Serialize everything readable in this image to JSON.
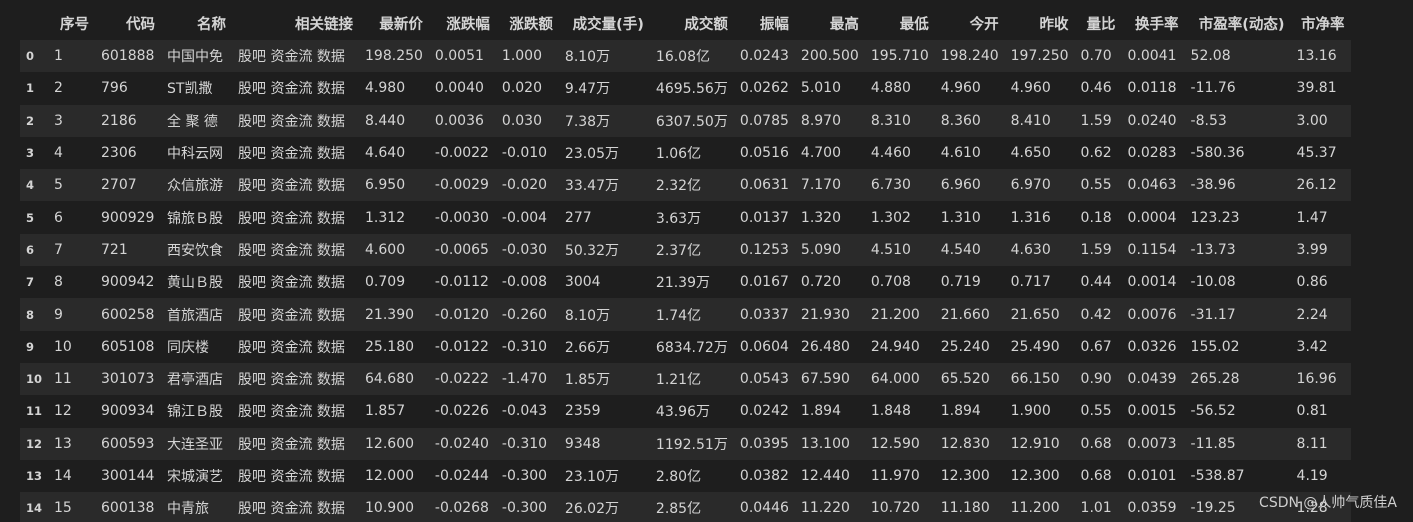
{
  "table": {
    "columns": [
      "",
      "序号",
      "代码",
      "名称",
      "相关链接",
      "最新价",
      "涨跌幅",
      "涨跌额",
      "成交量(手)",
      "成交额",
      "振幅",
      "最高",
      "最低",
      "今开",
      "昨收",
      "量比",
      "换手率",
      "市盈率(动态)",
      "市净率"
    ],
    "rows": [
      [
        "0",
        "1",
        "601888",
        "中国中免",
        "股吧 资金流 数据",
        "198.250",
        "0.0051",
        "1.000",
        "8.10万",
        "16.08亿",
        "0.0243",
        "200.500",
        "195.710",
        "198.240",
        "197.250",
        "0.70",
        "0.0041",
        "52.08",
        "13.16"
      ],
      [
        "1",
        "2",
        "796",
        "ST凯撒",
        "股吧 资金流 数据",
        "4.980",
        "0.0040",
        "0.020",
        "9.47万",
        "4695.56万",
        "0.0262",
        "5.010",
        "4.880",
        "4.960",
        "4.960",
        "0.46",
        "0.0118",
        "-11.76",
        "39.81"
      ],
      [
        "2",
        "3",
        "2186",
        "全 聚 德",
        "股吧 资金流 数据",
        "8.440",
        "0.0036",
        "0.030",
        "7.38万",
        "6307.50万",
        "0.0785",
        "8.970",
        "8.310",
        "8.360",
        "8.410",
        "1.59",
        "0.0240",
        "-8.53",
        "3.00"
      ],
      [
        "3",
        "4",
        "2306",
        "中科云网",
        "股吧 资金流 数据",
        "4.640",
        "-0.0022",
        "-0.010",
        "23.05万",
        "1.06亿",
        "0.0516",
        "4.700",
        "4.460",
        "4.610",
        "4.650",
        "0.62",
        "0.0283",
        "-580.36",
        "45.37"
      ],
      [
        "4",
        "5",
        "2707",
        "众信旅游",
        "股吧 资金流 数据",
        "6.950",
        "-0.0029",
        "-0.020",
        "33.47万",
        "2.32亿",
        "0.0631",
        "7.170",
        "6.730",
        "6.960",
        "6.970",
        "0.55",
        "0.0463",
        "-38.96",
        "26.12"
      ],
      [
        "5",
        "6",
        "900929",
        "锦旅Ｂ股",
        "股吧 资金流 数据",
        "1.312",
        "-0.0030",
        "-0.004",
        "277",
        "3.63万",
        "0.0137",
        "1.320",
        "1.302",
        "1.310",
        "1.316",
        "0.18",
        "0.0004",
        "123.23",
        "1.47"
      ],
      [
        "6",
        "7",
        "721",
        "西安饮食",
        "股吧 资金流 数据",
        "4.600",
        "-0.0065",
        "-0.030",
        "50.32万",
        "2.37亿",
        "0.1253",
        "5.090",
        "4.510",
        "4.540",
        "4.630",
        "1.59",
        "0.1154",
        "-13.73",
        "3.99"
      ],
      [
        "7",
        "8",
        "900942",
        "黄山Ｂ股",
        "股吧 资金流 数据",
        "0.709",
        "-0.0112",
        "-0.008",
        "3004",
        "21.39万",
        "0.0167",
        "0.720",
        "0.708",
        "0.719",
        "0.717",
        "0.44",
        "0.0014",
        "-10.08",
        "0.86"
      ],
      [
        "8",
        "9",
        "600258",
        "首旅酒店",
        "股吧 资金流 数据",
        "21.390",
        "-0.0120",
        "-0.260",
        "8.10万",
        "1.74亿",
        "0.0337",
        "21.930",
        "21.200",
        "21.660",
        "21.650",
        "0.42",
        "0.0076",
        "-31.17",
        "2.24"
      ],
      [
        "9",
        "10",
        "605108",
        "同庆楼",
        "股吧 资金流 数据",
        "25.180",
        "-0.0122",
        "-0.310",
        "2.66万",
        "6834.72万",
        "0.0604",
        "26.480",
        "24.940",
        "25.240",
        "25.490",
        "0.67",
        "0.0326",
        "155.02",
        "3.42"
      ],
      [
        "10",
        "11",
        "301073",
        "君亭酒店",
        "股吧 资金流 数据",
        "64.680",
        "-0.0222",
        "-1.470",
        "1.85万",
        "1.21亿",
        "0.0543",
        "67.590",
        "64.000",
        "65.520",
        "66.150",
        "0.90",
        "0.0439",
        "265.28",
        "16.96"
      ],
      [
        "11",
        "12",
        "900934",
        "锦江Ｂ股",
        "股吧 资金流 数据",
        "1.857",
        "-0.0226",
        "-0.043",
        "2359",
        "43.96万",
        "0.0242",
        "1.894",
        "1.848",
        "1.894",
        "1.900",
        "0.55",
        "0.0015",
        "-56.52",
        "0.81"
      ],
      [
        "12",
        "13",
        "600593",
        "大连圣亚",
        "股吧 资金流 数据",
        "12.600",
        "-0.0240",
        "-0.310",
        "9348",
        "1192.51万",
        "0.0395",
        "13.100",
        "12.590",
        "12.830",
        "12.910",
        "0.68",
        "0.0073",
        "-11.85",
        "8.11"
      ],
      [
        "13",
        "14",
        "300144",
        "宋城演艺",
        "股吧 资金流 数据",
        "12.000",
        "-0.0244",
        "-0.300",
        "23.10万",
        "2.80亿",
        "0.0382",
        "12.440",
        "11.970",
        "12.300",
        "12.300",
        "0.68",
        "0.0101",
        "-538.87",
        "4.19"
      ],
      [
        "14",
        "15",
        "600138",
        "中青旅",
        "股吧 资金流 数据",
        "10.900",
        "-0.0268",
        "-0.300",
        "26.02万",
        "2.85亿",
        "0.0446",
        "11.220",
        "10.720",
        "11.180",
        "11.200",
        "1.01",
        "0.0359",
        "-19.25",
        "1.28"
      ]
    ]
  },
  "watermark": "CSDN @人帅气质佳A"
}
